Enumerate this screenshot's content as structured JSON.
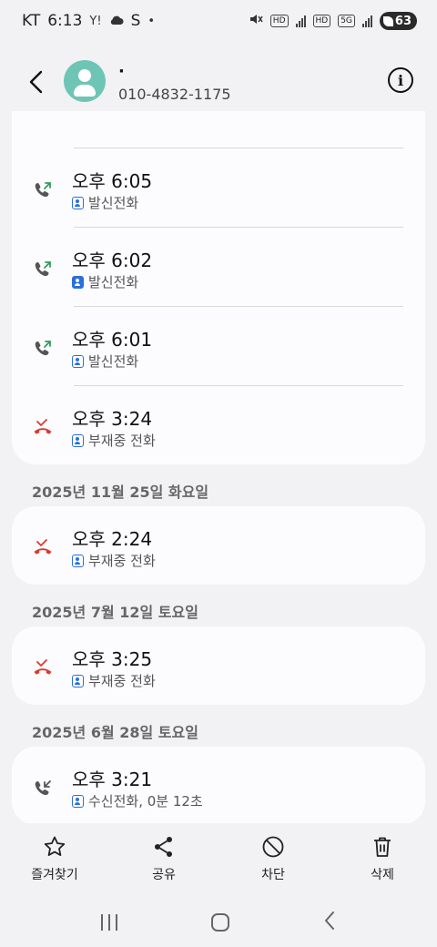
{
  "status_bar": {
    "carrier": "KT",
    "time": "6:13",
    "app_icons": [
      "Y!",
      "cloud-icon",
      "S"
    ],
    "dot": "•",
    "battery": "63"
  },
  "header": {
    "contact_name": "·",
    "contact_number": "010-4832-1175",
    "info_label": "i"
  },
  "calls_today": [
    {
      "time": "",
      "type": "발신전화",
      "kind": "outgoing"
    },
    {
      "time": "오후 6:05",
      "type": "발신전화",
      "kind": "outgoing"
    },
    {
      "time": "오후 6:02",
      "type": "발신전화",
      "kind": "outgoing"
    },
    {
      "time": "오후 6:01",
      "type": "발신전화",
      "kind": "outgoing"
    },
    {
      "time": "오후 3:24",
      "type": "부재중 전화",
      "kind": "missed"
    }
  ],
  "groups": [
    {
      "date": "2025년 11월 25일 화요일",
      "time": "오후 2:24",
      "type": "부재중 전화",
      "kind": "missed"
    },
    {
      "date": "2025년 7월 12일 토요일",
      "time": "오후 3:25",
      "type": "부재중 전화",
      "kind": "missed"
    },
    {
      "date": "2025년 6월 28일 토요일",
      "time": "오후 3:21",
      "type": "수신전화, 0분 12초",
      "kind": "incoming"
    }
  ],
  "actions": {
    "favorite": "즐겨찾기",
    "share": "공유",
    "block": "차단",
    "delete": "삭제"
  },
  "colors": {
    "outgoing": "#2f9e5b",
    "missed": "#d93b30",
    "incoming": "#555555",
    "accent": "#2a6fdb"
  }
}
